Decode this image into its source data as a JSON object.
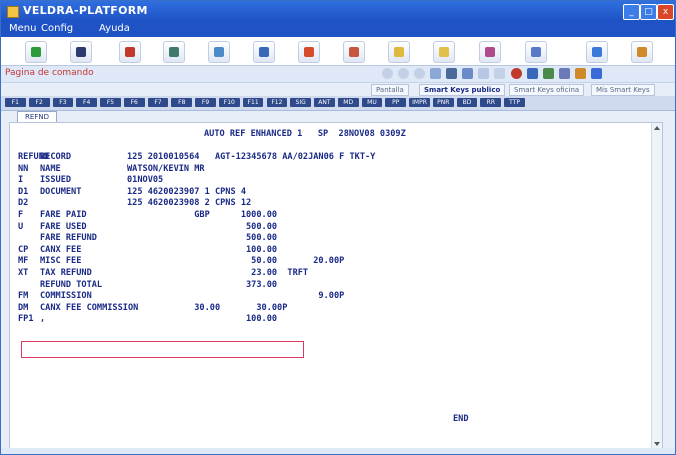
{
  "window": {
    "title": "VELDRA-PLATFORM",
    "controls": {
      "minimize": "_",
      "maximize": "□",
      "close": "x"
    }
  },
  "menu": {
    "items": [
      "Menu",
      "Config",
      "Ayuda"
    ]
  },
  "toolbar": {
    "icons": [
      "refresh-icon",
      "cancel-icon",
      "euro-icon",
      "printer-icon",
      "airplane-icon",
      "car-icon",
      "person-icon",
      "person-add-icon",
      "help-icon",
      "info-icon",
      "settings-icon",
      "user-icon",
      "globe-icon",
      "bell-icon"
    ]
  },
  "pagebar": {
    "label": "Pagina de comando"
  },
  "tabs": {
    "items": [
      "Pantalla",
      "Smart Keys publico",
      "Smart Keys oficina",
      "Mis Smart Keys"
    ]
  },
  "fkeys": {
    "items": [
      "F1",
      "F2",
      "F3",
      "F4",
      "F5",
      "F6",
      "F7",
      "F8",
      "F9",
      "F10",
      "F11",
      "F12",
      "SIG",
      "ANT",
      "MD",
      "MU",
      "PP",
      "IMPR",
      "PNR",
      "BD",
      "RR",
      "TTP"
    ]
  },
  "session": {
    "tab_label": "REFND"
  },
  "terminal": {
    "header": "AUTO REF ENHANCED 1   SP  28NOV08 0309Z",
    "rows": [
      {
        "c1": "REFUND",
        "c2": "RECORD",
        "c3": "125 2010010564   AGT-12345678 AA/02JAN06 F TKT-Y"
      },
      {
        "c1": "NN",
        "c2": "NAME",
        "c3": "WATSON/KEVIN MR"
      },
      {
        "c1": "I",
        "c2": "ISSUED",
        "c3": "01NOV05"
      },
      {
        "c1": "D1",
        "c2": "DOCUMENT",
        "c3": "125 4620023907 1 CPNS 4"
      },
      {
        "c1": "D2",
        "c2": "",
        "c3": "125 4620023908 2 CPNS 12"
      },
      {
        "c1": "F",
        "c2": "FARE PAID",
        "c3": "             GBP      1000.00"
      },
      {
        "c1": "U",
        "c2": "FARE USED",
        "c3": "                       500.00"
      },
      {
        "c1": "",
        "c2": "FARE REFUND",
        "c3": "                       500.00"
      },
      {
        "c1": "CP",
        "c2": "CANX FEE",
        "c3": "                       100.00"
      },
      {
        "c1": "MF",
        "c2": "MISC FEE",
        "c3": "                        50.00       20.00P"
      },
      {
        "c1": "XT",
        "c2": "TAX REFUND",
        "c3": "                        23.00  TRFT"
      },
      {
        "c1": "",
        "c2": "REFUND TOTAL",
        "c3": "                       373.00"
      },
      {
        "c1": "FM",
        "c2": "COMMISSION",
        "c3": "                                     9.00P"
      },
      {
        "c1": "DM",
        "c2": "CANX FEE COMMISSION",
        "c3": "             30.00       30.00P"
      },
      {
        "c1": "FP1",
        "c2": ",",
        "c3": "                       100.00"
      }
    ],
    "end_marker": "END"
  },
  "colors": {
    "terminal_text": "#1a2a86",
    "highlight": "#d93a5e",
    "titlebar": "#1f52c4"
  }
}
